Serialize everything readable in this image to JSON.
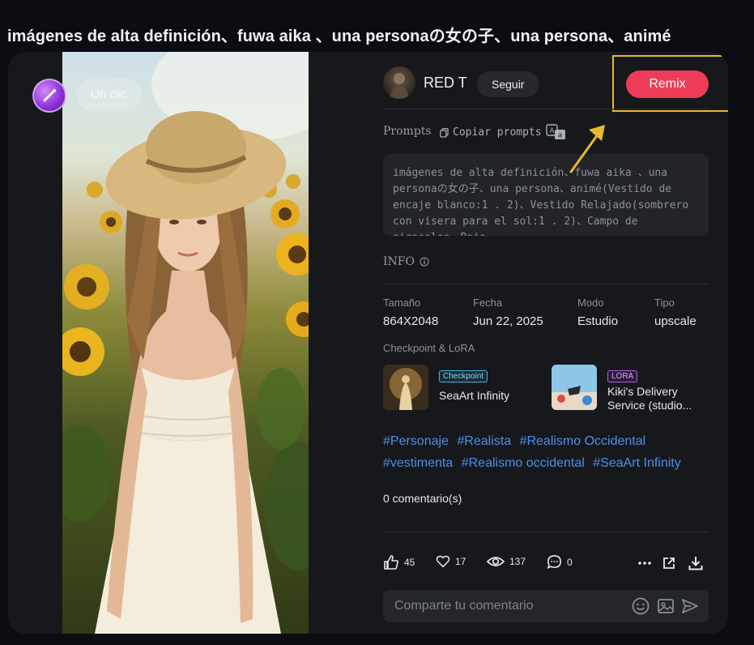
{
  "page_title": "imágenes de alta definición、fuwa aika 、una personaの女の子、una persona、animé",
  "image": {
    "one_click_label": "Un clic"
  },
  "author": {
    "name": "RED T",
    "follow_label": "Seguir"
  },
  "remix_label": "Remix",
  "prompts": {
    "label": "Prompts",
    "copy_label": "Copiar prompts",
    "text": "imágenes de alta definición、fuwa aika 、una personaの女の子、una persona、animé(Vestido de encaje blanco:1 . 2)、Vestido Relajado(sombrero con visera para el sol:1 . 2)、Campo de girasoles、Bajo"
  },
  "info": {
    "label": "INFO",
    "fields": [
      {
        "key": "Tamaño",
        "value": "864X2048"
      },
      {
        "key": "Fecha",
        "value": "Jun 22, 2025"
      },
      {
        "key": "Modo",
        "value": "Estudio"
      },
      {
        "key": "Tipo",
        "value": "upscale"
      }
    ]
  },
  "checkpoint_lora": {
    "label": "Checkpoint & LoRA",
    "models": [
      {
        "badge": "Checkpoint",
        "name": "SeaArt Infinity"
      },
      {
        "badge": "LORA",
        "name": "Kiki's Delivery Service (studio..."
      }
    ]
  },
  "tags": [
    "#Personaje",
    "#Realista",
    "#Realismo Occidental",
    "#vestimenta",
    "#Realismo occidental",
    "#SeaArt Infinity"
  ],
  "comments_count": "0 comentario(s)",
  "stats": {
    "likes": "45",
    "favorites": "17",
    "views": "137",
    "comments": "0"
  },
  "comment_placeholder": "Comparte tu comentario",
  "colors": {
    "accent_remix": "#ee3b57",
    "highlight_frame": "#e8b82f",
    "tag_link": "#4e8ee6"
  }
}
